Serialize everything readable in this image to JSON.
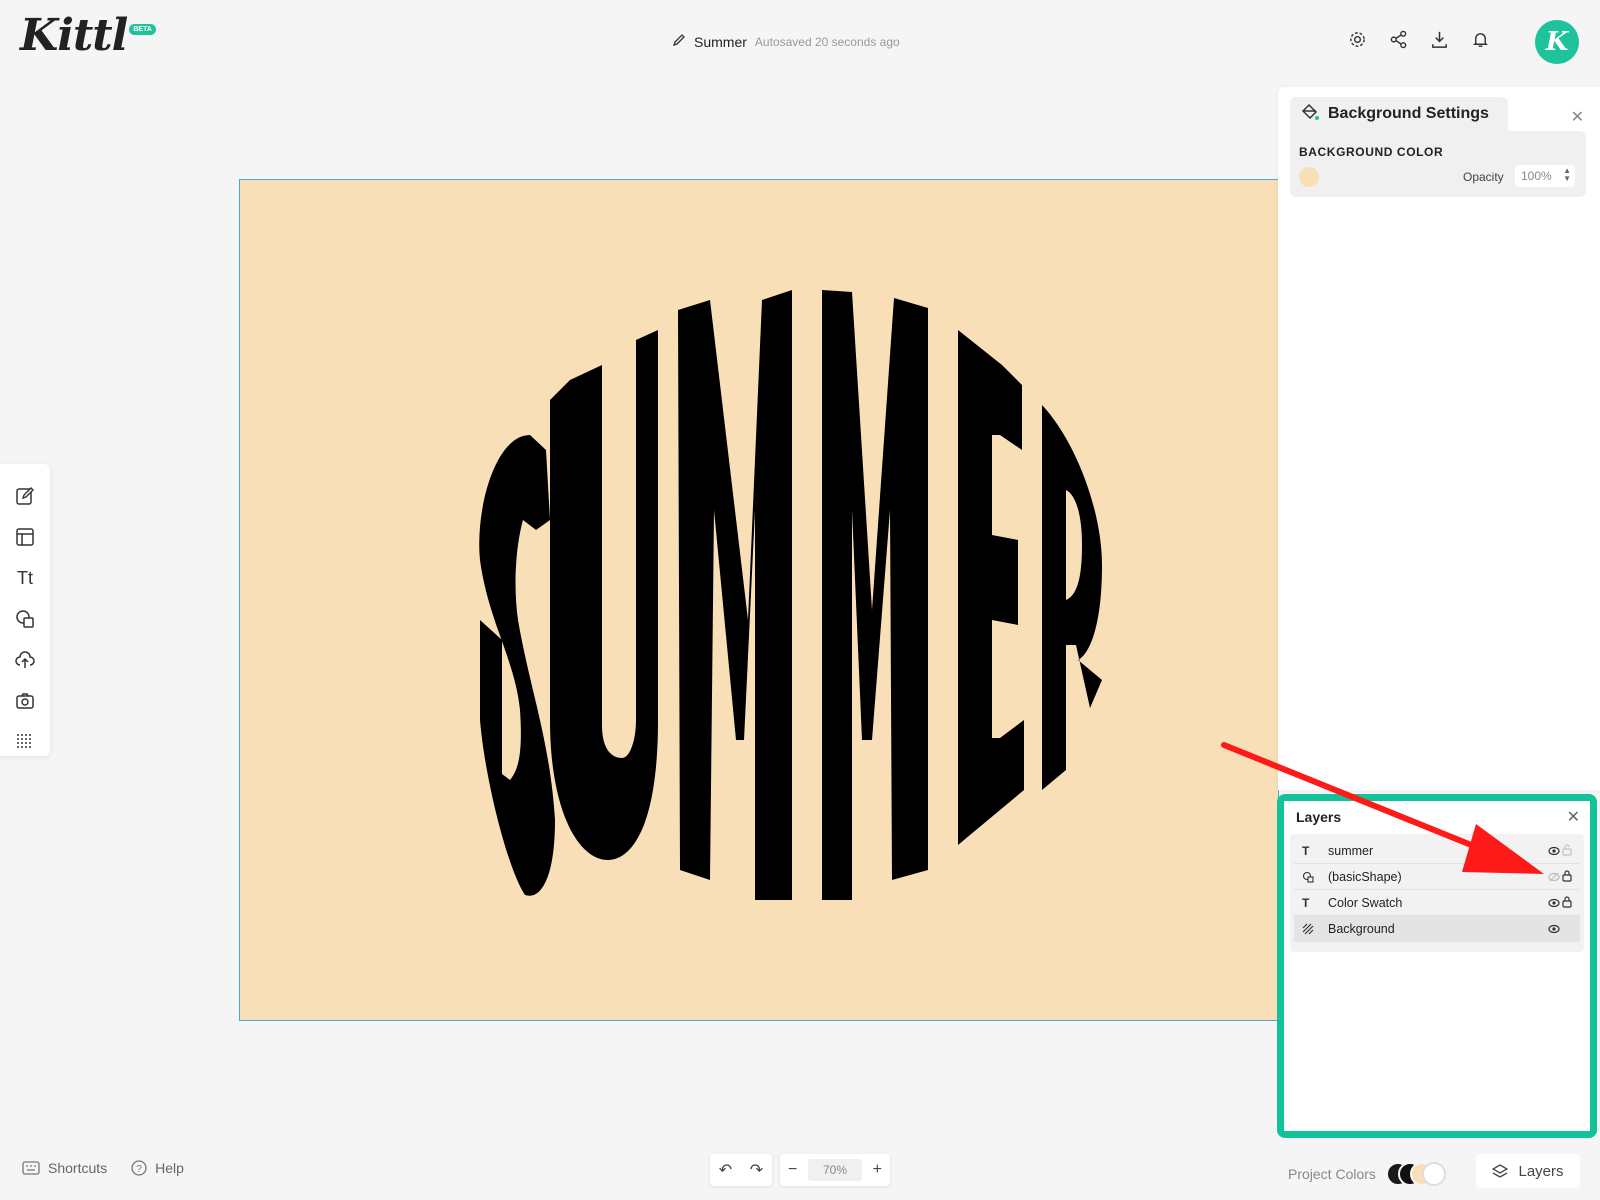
{
  "app": {
    "logo": "Kittl",
    "beta_badge": "BETA",
    "avatar_letter": "K",
    "accent_color": "#1fc39b"
  },
  "header": {
    "doc_name": "Summer",
    "autosave_status": "Autosaved 20 seconds ago",
    "icons": [
      "settings-icon",
      "share-icon",
      "download-icon",
      "bell-icon"
    ]
  },
  "canvas": {
    "text": "SUMMER",
    "background_color": "#f9dfb8",
    "text_color": "#000000"
  },
  "left_toolbar": {
    "tools": [
      "edit-icon",
      "templates-icon",
      "text-icon",
      "shapes-icon",
      "upload-icon",
      "camera-icon",
      "pattern-icon"
    ],
    "text_tool_glyph": "Tt"
  },
  "background_settings": {
    "title": "Background Settings",
    "section_label": "BACKGROUND COLOR",
    "opacity_label": "Opacity",
    "opacity_value": "100%",
    "color": "#f9dfb8"
  },
  "layers_panel": {
    "title": "Layers",
    "items": [
      {
        "type_glyph": "T",
        "name": "summer",
        "visible": true,
        "locked": false
      },
      {
        "type_glyph": "shape",
        "name": "(basicShape)",
        "visible": false,
        "locked": true
      },
      {
        "type_glyph": "T",
        "name": "Color Swatch",
        "visible": true,
        "locked": true
      },
      {
        "type_glyph": "pattern",
        "name": "Background",
        "visible": true,
        "locked": false
      }
    ]
  },
  "bottom_bar": {
    "shortcuts_label": "Shortcuts",
    "help_label": "Help",
    "zoom_value": "70%",
    "project_colors_label": "Project Colors",
    "project_colors": [
      "#1a1a1a",
      "#111111",
      "#f9dfb8",
      "#ffffff"
    ],
    "layers_button_label": "Layers"
  }
}
